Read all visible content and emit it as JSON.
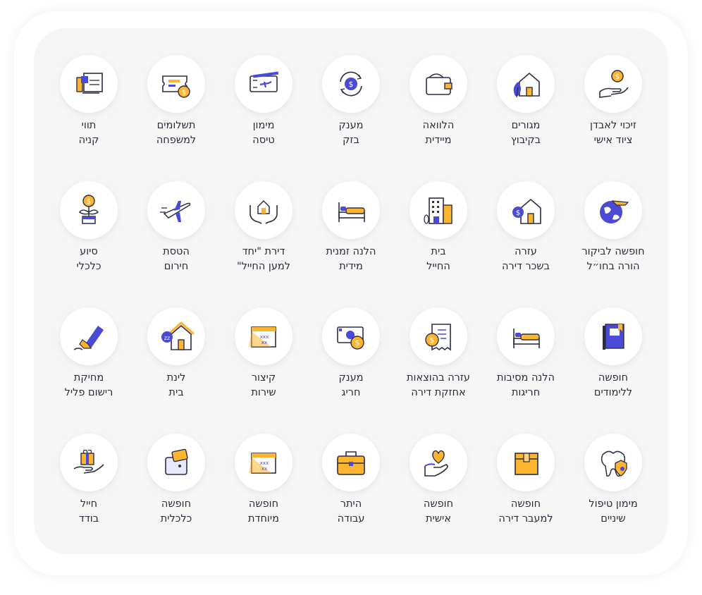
{
  "colors": {
    "blue": "#4a4ad6",
    "orange": "#fdb42e",
    "outline": "#2d2d44"
  },
  "tiles": [
    {
      "line1": "זיכוי לאבדן",
      "line2": "ציוד אישי",
      "icon": "hand-coin-icon"
    },
    {
      "line1": "מגורים",
      "line2": "בקיבוץ",
      "icon": "house-leaf-icon"
    },
    {
      "line1": "הלוואה",
      "line2": "מיידית",
      "icon": "wallet-icon"
    },
    {
      "line1": "מענק",
      "line2": "בזק",
      "icon": "coin-cycle-icon"
    },
    {
      "line1": "מימון",
      "line2": "טיסה",
      "icon": "flight-ticket-icon"
    },
    {
      "line1": "תשלומים",
      "line2": "למשפחה",
      "icon": "payment-ticket-icon"
    },
    {
      "line1": "תווי",
      "line2": "קניה",
      "icon": "voucher-icon"
    },
    {
      "line1": "חופשה לביקור",
      "line2": "הורה בחו״ל",
      "icon": "globe-plane-icon"
    },
    {
      "line1": "עזרה",
      "line2": "בשכר דירה",
      "icon": "house-coin-icon"
    },
    {
      "line1": "בית",
      "line2": "החייל",
      "icon": "building-icon"
    },
    {
      "line1": "הלנה זמנית",
      "line2": "מידית",
      "icon": "bed-icon"
    },
    {
      "line1": "דירת \"יחד",
      "line2": "למען החייל\"",
      "icon": "hands-house-icon"
    },
    {
      "line1": "הטסת",
      "line2": "חירום",
      "icon": "airplane-icon"
    },
    {
      "line1": "סיוע",
      "line2": "כלכלי",
      "icon": "money-plant-icon"
    },
    {
      "line1": "חופשה",
      "line2": "ללימודים",
      "icon": "book-icon"
    },
    {
      "line1": "הלנה מסיבות",
      "line2": "חריגות",
      "icon": "bed-icon"
    },
    {
      "line1": "עזרה בהוצאות",
      "line2": "אחזקת דירה",
      "icon": "receipt-coin-icon"
    },
    {
      "line1": "מענק",
      "line2": "חריג",
      "icon": "banknote-coin-icon"
    },
    {
      "line1": "קיצור",
      "line2": "שירות",
      "icon": "calendar-icon"
    },
    {
      "line1": "לינת",
      "line2": "בית",
      "icon": "house-sleep-icon"
    },
    {
      "line1": "מחיקת",
      "line2": "רישום פליל",
      "icon": "eraser-icon"
    },
    {
      "line1": "מימון טיפול",
      "line2": "שיניים",
      "icon": "tooth-icon"
    },
    {
      "line1": "חופשה",
      "line2": "למעבר דירה",
      "icon": "box-icon"
    },
    {
      "line1": "חופשה",
      "line2": "אישית",
      "icon": "hand-heart-icon"
    },
    {
      "line1": "היתר",
      "line2": "עבודה",
      "icon": "briefcase-icon"
    },
    {
      "line1": "חופשה",
      "line2": "מיוחדת",
      "icon": "calendar-icon"
    },
    {
      "line1": "חופשה",
      "line2": "כלכלית",
      "icon": "wallet-card-icon"
    },
    {
      "line1": "חייל",
      "line2": "בודד",
      "icon": "hand-gift-icon"
    }
  ]
}
